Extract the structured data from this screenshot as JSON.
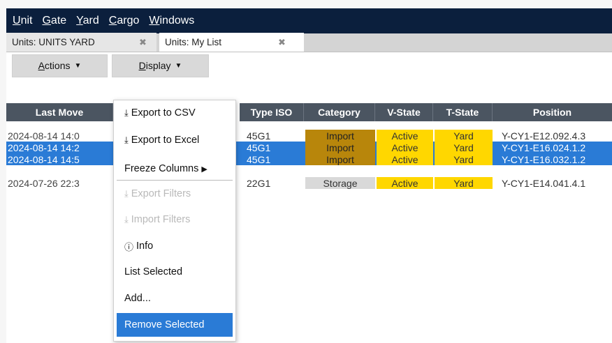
{
  "menu": {
    "items": [
      {
        "mnemonic": "U",
        "rest": "nit"
      },
      {
        "mnemonic": "G",
        "rest": "ate"
      },
      {
        "mnemonic": "Y",
        "rest": "ard"
      },
      {
        "mnemonic": "C",
        "rest": "argo"
      },
      {
        "mnemonic": "W",
        "rest": "indows"
      }
    ]
  },
  "tabs": {
    "tab1": "Units: UNITS YARD",
    "tab2": "Units: My List",
    "close_glyph": "✖"
  },
  "toolbar": {
    "actions_mn": "A",
    "actions_rest": "ctions",
    "display_mn": "D",
    "display_rest": "isplay",
    "caret": "▼"
  },
  "grid": {
    "headers": {
      "last_move": "Last Move",
      "type_iso": "Type ISO",
      "category": "Category",
      "v_state": "V-State",
      "t_state": "T-State",
      "position": "Position"
    },
    "rows": [
      {
        "last_move": "2024-08-14 14:0",
        "type_iso": "45G1",
        "category": "Import",
        "v_state": "Active",
        "t_state": "Yard",
        "position": "Y-CY1-E12.092.4.3"
      },
      {
        "last_move": "2024-08-14 14:2",
        "type_iso": "45G1",
        "category": "Import",
        "v_state": "Active",
        "t_state": "Yard",
        "position": "Y-CY1-E16.024.1.2"
      },
      {
        "last_move": "2024-08-14 14:5",
        "type_iso": "45G1",
        "category": "Import",
        "v_state": "Active",
        "t_state": "Yard",
        "position": "Y-CY1-E16.032.1.2"
      },
      {
        "last_move": "2024-07-26 22:3",
        "type_iso": "22G1",
        "category": "Storage",
        "v_state": "Active",
        "t_state": "Yard",
        "position": "Y-CY1-E14.041.4.1"
      }
    ],
    "selected_rows": [
      1,
      2
    ]
  },
  "dropdown": {
    "download_glyph": "⤓",
    "info_glyph": "ⓘ",
    "arrow_glyph": "▶",
    "export_csv": "Export to CSV",
    "export_excel": "Export to Excel",
    "freeze_columns": "Freeze Columns",
    "export_filters": "Export Filters",
    "import_filters": "Import Filters",
    "info": "Info",
    "list_selected": "List Selected",
    "add": "Add...",
    "remove_selected": "Remove Selected"
  }
}
